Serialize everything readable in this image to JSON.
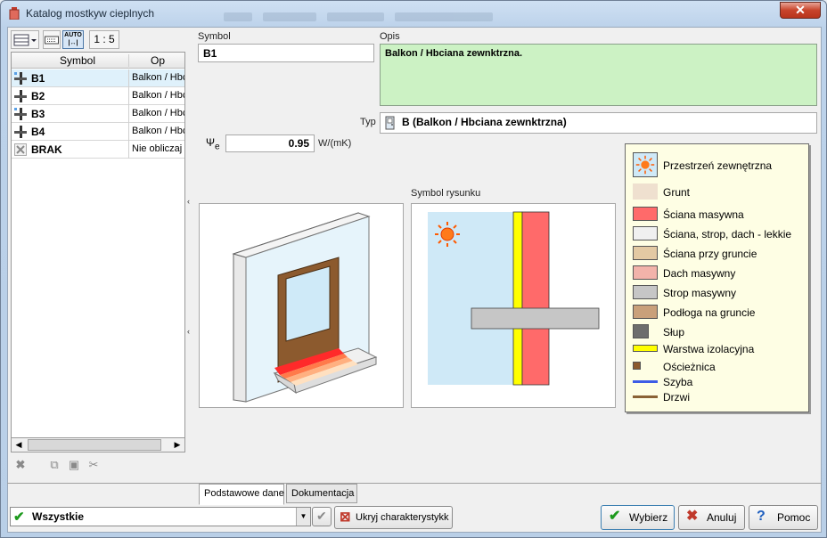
{
  "window": {
    "title": "Katalog mostkyw cieplnych",
    "close_label": "✕"
  },
  "left": {
    "scale_label": "1 : 5",
    "auto_label": "AUTO",
    "columns": [
      "Symbol",
      "Op"
    ],
    "rows": [
      {
        "symbol": "B1",
        "desc": "Balkon / Hbc",
        "icon": "thermal-bridge-icon"
      },
      {
        "symbol": "B2",
        "desc": "Balkon / Hbc",
        "icon": "thermal-bridge-icon"
      },
      {
        "symbol": "B3",
        "desc": "Balkon / Hbc",
        "icon": "thermal-bridge-icon"
      },
      {
        "symbol": "B4",
        "desc": "Balkon / Hbc",
        "icon": "thermal-bridge-icon"
      },
      {
        "symbol": "BRAK",
        "desc": "Nie obliczaj",
        "icon": "cross-icon"
      }
    ]
  },
  "form": {
    "symbol_label": "Symbol",
    "symbol_value": "B1",
    "opis_label": "Opis",
    "opis_value": "Balkon / Hbciana zewnktrzna.",
    "typ_label": "Typ",
    "typ_value": "B (Balkon / Hbciana zewnktrzna)",
    "psi_symbol": "Ψ",
    "psi_sub": "e",
    "psi_value": "0.95",
    "psi_unit": "W/(mK)",
    "drawing_label": "Symbol rysunku"
  },
  "legend": [
    {
      "label": "Przestrzeń zewnętrzna",
      "color": "#cfe9f7"
    },
    {
      "label": "Grunt",
      "color": "#efe0cf"
    },
    {
      "label": "Ściana masywna",
      "color": "#ff6a6a"
    },
    {
      "label": "Ściana, strop, dach - lekkie",
      "color": "#f0f0f0"
    },
    {
      "label": "Ściana przy gruncie",
      "color": "#e3c9a3"
    },
    {
      "label": "Dach masywny",
      "color": "#f2b3aa"
    },
    {
      "label": "Strop masywny",
      "color": "#c6c6c6"
    },
    {
      "label": "Podłoga na gruncie",
      "color": "#c9a07a"
    },
    {
      "label": "Słup",
      "color": "#6d6d6d"
    },
    {
      "label": "Warstwa izolacyjna",
      "color": "#ffff00"
    },
    {
      "label": "Ościeżnica",
      "color": "#8c5a2e"
    },
    {
      "label": "Szyba",
      "color": "#3d5ce6"
    },
    {
      "label": "Drzwi",
      "color": "#8a6235"
    }
  ],
  "tabs": {
    "basic": "Podstawowe dane",
    "docs": "Dokumentacja"
  },
  "footer": {
    "filter_value": "Wszystkie",
    "hide_label": "Ukryj charakterystykk",
    "select_label": "Wybierz",
    "cancel_label": "Anuluj",
    "help_label": "Pomoc"
  }
}
